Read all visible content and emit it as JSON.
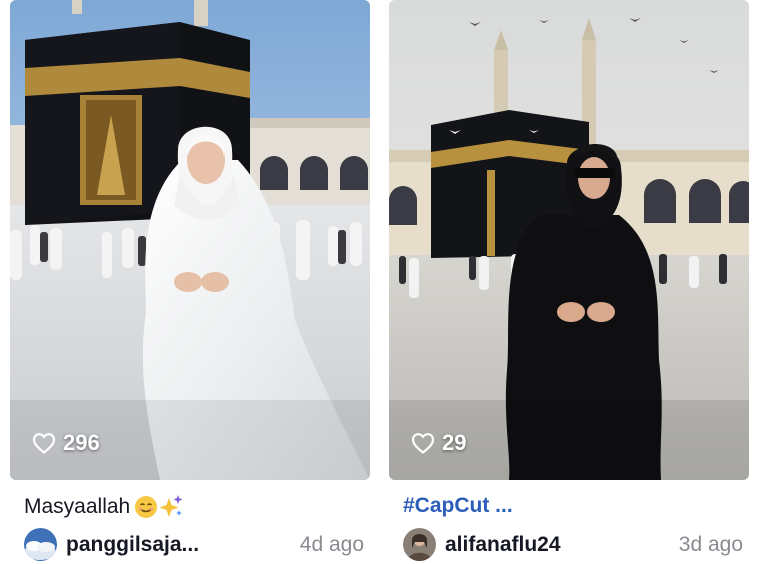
{
  "videos": [
    {
      "likes": "296",
      "caption": "Masyaallah",
      "emoji": [
        "smiling-face-icon",
        "sparkles-icon"
      ],
      "username": "panggilsaja...",
      "time": "4d ago"
    },
    {
      "likes": "29",
      "caption": "#CapCut ...",
      "username": "alifanaflu24",
      "time": "3d ago"
    }
  ],
  "colors": {
    "hashtag": "#2b5db9",
    "text": "#161823",
    "muted": "#8a8b91"
  }
}
